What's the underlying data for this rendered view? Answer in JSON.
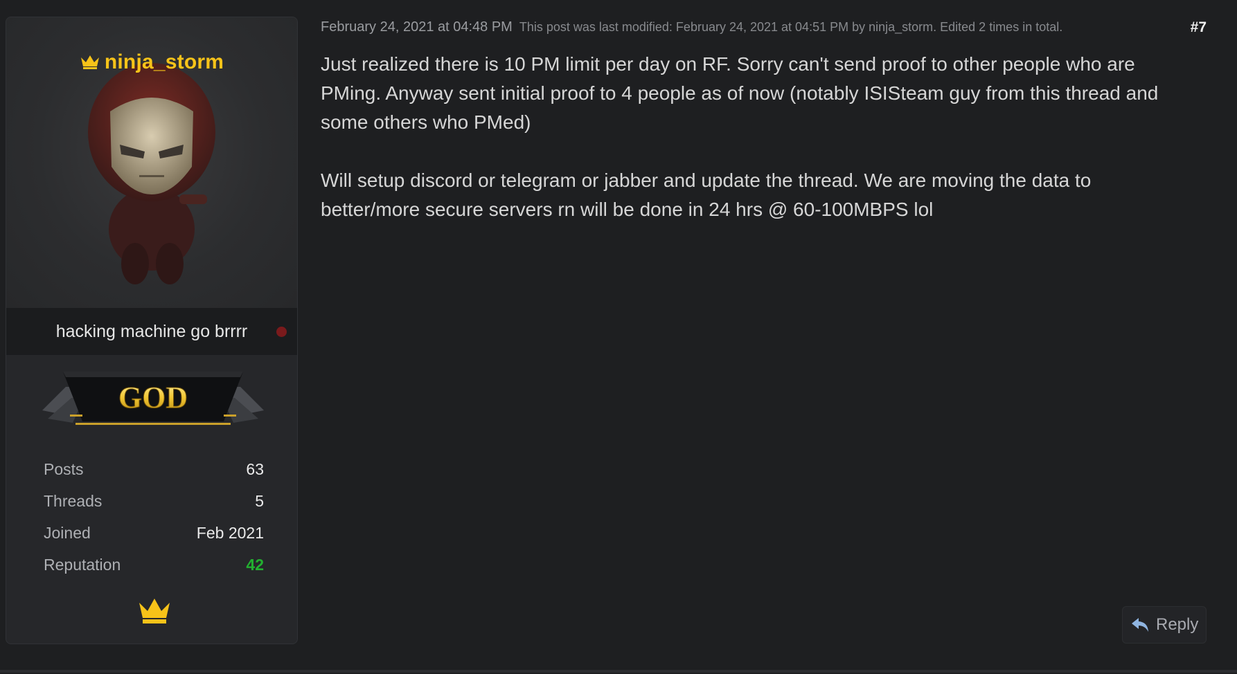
{
  "user": {
    "username": "ninja_storm",
    "title": "hacking machine go brrrr",
    "rank": "GOD",
    "status_color": "#7a1a1c",
    "name_color": "#f7c319",
    "stats": [
      {
        "label": "Posts",
        "value": "63"
      },
      {
        "label": "Threads",
        "value": "5"
      },
      {
        "label": "Joined",
        "value": "Feb 2021"
      },
      {
        "label": "Reputation",
        "value": "42"
      }
    ],
    "reputation_color": "#22b030",
    "badge_icon": "crown-icon"
  },
  "post": {
    "date": "February 24, 2021 at 04:48 PM",
    "edit_note": "This post was last modified: February 24, 2021 at 04:51 PM by ninja_storm. Edited 2 times in total.",
    "number": "#7",
    "paragraphs": [
      "Just realized there is 10 PM limit per day on RF. Sorry can't send proof to other people who are PMing. Anyway sent initial proof to 4 people as of now (notably ISISteam guy from this thread and some others who PMed)",
      "Will setup discord or telegram or jabber and update the thread. We are moving the data to better/more secure servers rn will be done in 24 hrs @ 60-100MBPS lol"
    ],
    "reply_label": "Reply",
    "reply_icon": "reply-arrow-icon"
  }
}
